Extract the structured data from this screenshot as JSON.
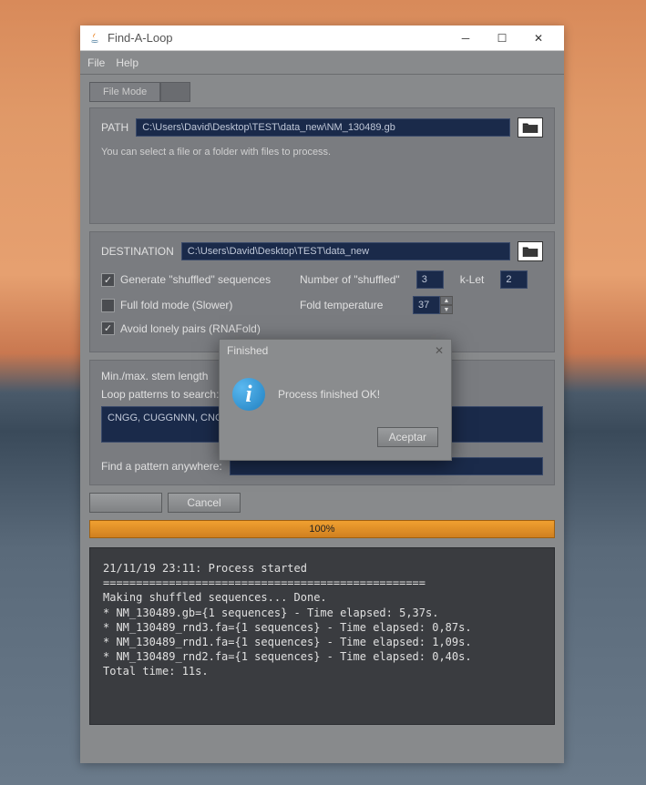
{
  "window": {
    "title": "Find-A-Loop"
  },
  "menubar": {
    "file": "File",
    "help": "Help"
  },
  "tabs": {
    "active": "File Mode"
  },
  "path": {
    "label": "PATH",
    "value": "C:\\Users\\David\\Desktop\\TEST\\data_new\\NM_130489.gb",
    "hint": "You can select a file or a folder with files to process."
  },
  "destination": {
    "label": "DESTINATION",
    "value": "C:\\Users\\David\\Desktop\\TEST\\data_new"
  },
  "options": {
    "generate_shuffled": {
      "label": "Generate \"shuffled\" sequences",
      "checked": true
    },
    "number_shuffled": {
      "label": "Number of \"shuffled\"",
      "value": "3"
    },
    "klet": {
      "label": "k-Let",
      "value": "2"
    },
    "full_fold": {
      "label": "Full fold mode (Slower)",
      "checked": false
    },
    "fold_temp": {
      "label": "Fold temperature",
      "value": "37"
    },
    "avoid_lonely": {
      "label": "Avoid lonely pairs (RNAFold)",
      "checked": true
    }
  },
  "stem": {
    "minmax_label": "Min./max. stem length",
    "loop_label": "Loop patterns to search:",
    "patterns": "CNGG, CUGGNNN, CNGG",
    "anywhere_label": "Find a pattern anywhere:"
  },
  "buttons": {
    "cancel": "Cancel"
  },
  "progress": {
    "text": "100%"
  },
  "console": {
    "text": "21/11/19 23:11: Process started\n=================================================\nMaking shuffled sequences... Done.\n* NM_130489.gb={1 sequences} - Time elapsed: 5,37s.\n* NM_130489_rnd3.fa={1 sequences} - Time elapsed: 0,87s.\n* NM_130489_rnd1.fa={1 sequences} - Time elapsed: 1,09s.\n* NM_130489_rnd2.fa={1 sequences} - Time elapsed: 0,40s.\nTotal time: 11s."
  },
  "dialog": {
    "title": "Finished",
    "message": "Process finished OK!",
    "accept": "Aceptar"
  }
}
